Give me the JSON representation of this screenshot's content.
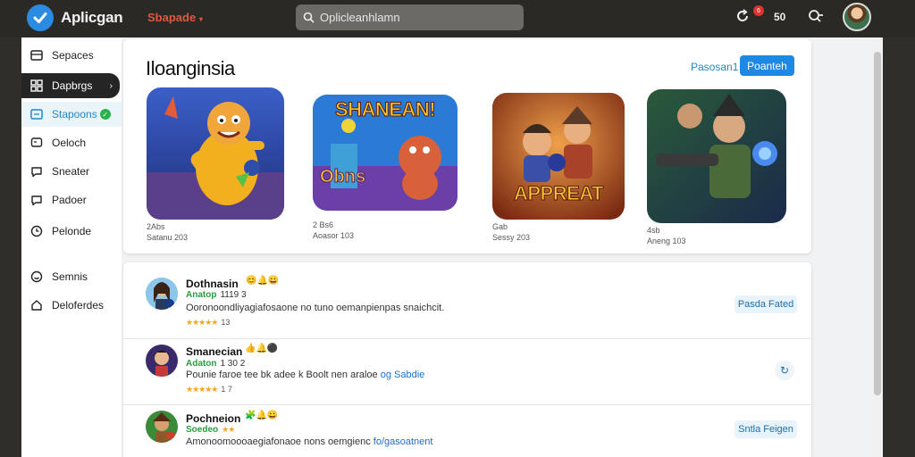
{
  "header": {
    "app_title": "Aplicgan",
    "category_dropdown": "Sbapade",
    "search_placeholder": "Oplicleanhlamn",
    "coin_count": "50",
    "notification_badge": "6"
  },
  "sidebar": {
    "items": [
      {
        "label": "Sepaces",
        "icon": "list-icon"
      },
      {
        "label": "Dapbrgs",
        "icon": "grid-icon"
      },
      {
        "label": "Stapoons",
        "icon": "list-icon"
      },
      {
        "label": "Oeloch",
        "icon": "chat-icon"
      },
      {
        "label": "Sneater",
        "icon": "chat-icon"
      },
      {
        "label": "Padoer",
        "icon": "chat-icon"
      },
      {
        "label": "Pelonde",
        "icon": "clock-icon"
      },
      {
        "label": "Semnis",
        "icon": "smile-icon"
      },
      {
        "label": "Deloferdes",
        "icon": "home-icon"
      }
    ]
  },
  "featured": {
    "title": "Iloanginsia",
    "see_all": "Pasosan1",
    "primary_button": "Poanteh",
    "games": [
      {
        "art_text": "",
        "line1": "2Abs",
        "line2": "Satanu 203"
      },
      {
        "art_text": "SHANEAN!",
        "line1": "2 Bs6",
        "line2": "Aoasor 103"
      },
      {
        "art_text": "APPREAT",
        "line1": "Gab",
        "line2": "Sessy 203"
      },
      {
        "art_text": "",
        "line1": "4sb",
        "line2": "Aneng 103"
      }
    ]
  },
  "list": {
    "rows": [
      {
        "name": "Dothnasin",
        "sub_green": "Anatop",
        "sub": "1119 3",
        "desc": "Ooronoondliyagiafosaone no tuno oemanpienpas snaichcit.",
        "desc_link": "",
        "rating": "13",
        "button": "Pasda Fated"
      },
      {
        "name": "Smanecian",
        "sub_green": "Adaton",
        "sub": "1 30 2",
        "desc": "Pounie faroe tee bk adee k Boolt nen araloe",
        "desc_link": "og Sabdie",
        "rating": "1 7",
        "button": ""
      },
      {
        "name": "Pochneion",
        "sub_green": "Soedeo",
        "sub": "",
        "desc": "Amonoomoooaegiafonaoe nons oemgienc",
        "desc_link": "fo/gasoatnent",
        "rating": "",
        "button": "Sntla Feigen"
      }
    ]
  },
  "colors": {
    "accent": "#1e88e5",
    "topbar": "#2b2925",
    "sidebar_active": "#1e88c8",
    "badge_red": "#e0322f"
  }
}
